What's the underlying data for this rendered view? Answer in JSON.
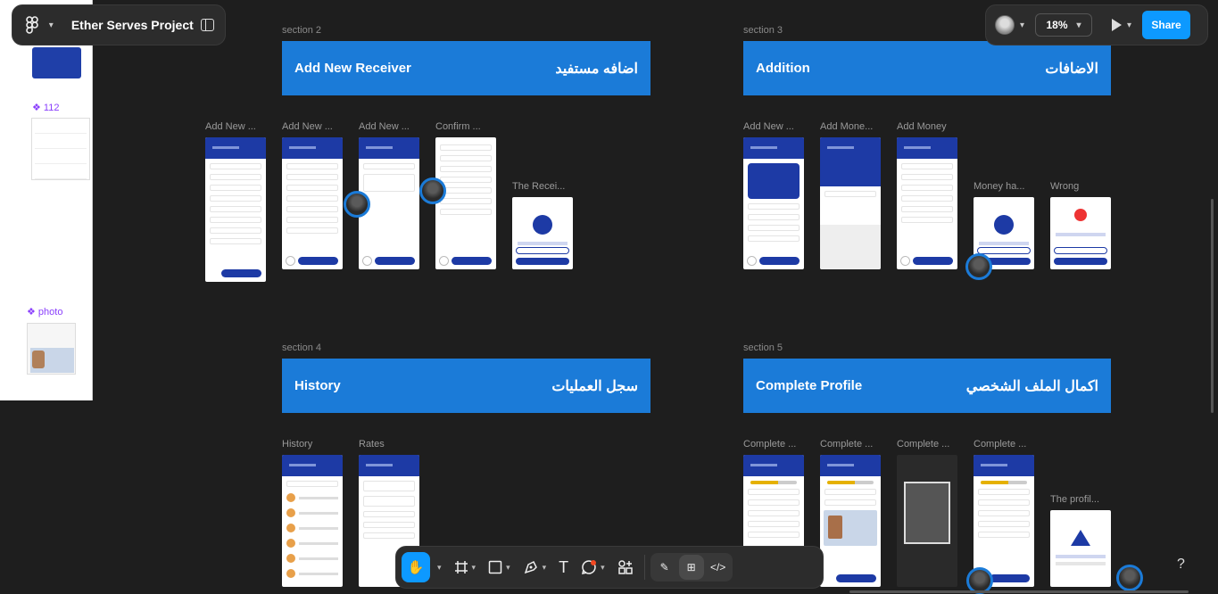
{
  "project": {
    "title": "Ether Serves Project"
  },
  "toolbar_right": {
    "zoom": "18%",
    "share_label": "Share"
  },
  "left_panel": {
    "component_112": "❖ 112",
    "component_photo": "❖ photo"
  },
  "sections": [
    {
      "label": "section 2",
      "banner_en": "Add  New Receiver",
      "banner_ar": "اضافه مستفيد",
      "frames": [
        "Add  New ...",
        "Add  New ...",
        "Add  New ...",
        "Confirm  ...",
        "The Recei..."
      ]
    },
    {
      "label": "section 3",
      "banner_en": "Addition",
      "banner_ar": "الاضافات",
      "frames": [
        "Add  New ...",
        "Add Mone...",
        "Add Money",
        "Money ha...",
        "Wrong"
      ]
    },
    {
      "label": "section 4",
      "banner_en": "History",
      "banner_ar": "سجل العمليات",
      "frames": [
        "History",
        "Rates"
      ]
    },
    {
      "label": "section 5",
      "banner_en": "Complete  Profile",
      "banner_ar": "اكمال الملف الشخصي",
      "frames": [
        "Complete ...",
        "Complete ...",
        "Complete ...",
        "Complete ...",
        "The profil..."
      ]
    }
  ],
  "bottom_toolbar": {
    "tools": [
      "hand-tool",
      "frame-tool",
      "shape-tool",
      "pen-tool",
      "text-tool",
      "comment-tool",
      "actions-tool"
    ],
    "text_glyph": "T",
    "help": "?"
  },
  "colors": {
    "accent": "#0d99ff",
    "banner": "#1b7bd8",
    "canvas": "#1e1e1e",
    "app_primary": "#1d3aa5"
  }
}
